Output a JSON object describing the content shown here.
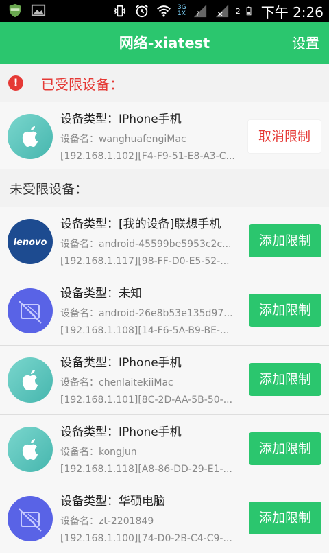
{
  "status_bar": {
    "time": "下午 2:26",
    "sim_badge": "2",
    "data_badge_top": "3G",
    "data_badge_bottom": "1X"
  },
  "title_bar": {
    "title": "网络-xiatest",
    "settings_label": "设置"
  },
  "restricted": {
    "header": "已受限设备：",
    "devices": [
      {
        "icon": "apple-icon",
        "type_line": "设备类型：IPhone手机",
        "name_line": "设备名：wanghuafengiMac",
        "addr_line": "[192.168.1.102][F4-F9-51-E8-A3-C...",
        "button_label": "取消限制"
      }
    ]
  },
  "unrestricted": {
    "header": "未受限设备：",
    "devices": [
      {
        "icon": "lenovo-logo",
        "logo_text": "lenovo",
        "type_line": "设备类型：[我的设备]联想手机",
        "name_line": "设备名：android-45599be5953c2c...",
        "addr_line": "[192.168.1.117][98-FF-D0-E5-52-...",
        "button_label": "添加限制"
      },
      {
        "icon": "unknown-device-icon",
        "type_line": "设备类型：未知",
        "name_line": "设备名：android-26e8b53e135d97...",
        "addr_line": "[192.168.1.108][14-F6-5A-B9-BE-...",
        "button_label": "添加限制"
      },
      {
        "icon": "apple-icon",
        "type_line": "设备类型：IPhone手机",
        "name_line": "设备名：chenlaitekiiMac",
        "addr_line": "[192.168.1.101][8C-2D-AA-5B-50-...",
        "button_label": "添加限制"
      },
      {
        "icon": "apple-icon",
        "type_line": "设备类型：IPhone手机",
        "name_line": "设备名：kongjun",
        "addr_line": "[192.168.1.118][A8-86-DD-29-E1-...",
        "button_label": "添加限制"
      },
      {
        "icon": "unknown-device-icon",
        "type_line": "设备类型：华硕电脑",
        "name_line": "设备名：zt-2201849",
        "addr_line": "[192.168.1.100][74-D0-2B-C4-C9-...",
        "button_label": "添加限制"
      }
    ]
  },
  "colors": {
    "accent_green": "#2bc66e",
    "alert_red": "#e53935",
    "lenovo_blue": "#1d4b90",
    "unknown_purple": "#5963e6",
    "apple_teal": "#5cc7bf"
  }
}
